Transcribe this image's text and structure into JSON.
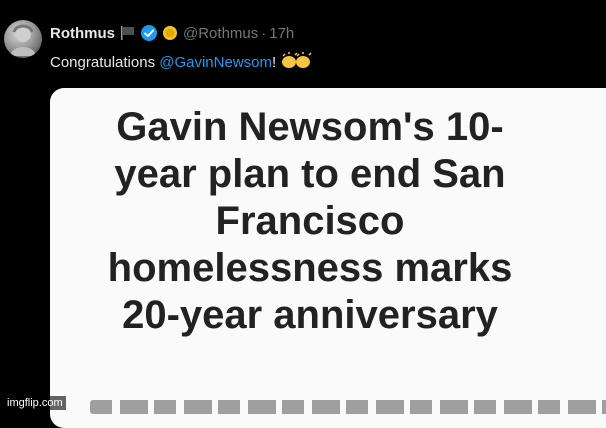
{
  "tweet": {
    "display_name": "Rothmus",
    "handle": "@Rothmus",
    "separator": "·",
    "time": "17h",
    "text_prefix": "Congratulations ",
    "mention": "@GavinNewsom",
    "text_suffix": "!",
    "icons": [
      "avatar",
      "flag-icon",
      "verified-badge-icon",
      "coin-icon",
      "clapping-hands-icon"
    ]
  },
  "card": {
    "headline_lines": [
      "Gavin Newsom's 10-",
      "year plan to end San",
      "Francisco",
      "homelessness marks",
      "20-year anniversary"
    ]
  },
  "watermark": "imgflip.com",
  "colors": {
    "background": "#000000",
    "mention": "#1d9bf0",
    "verified": "#1d9bf0",
    "muted": "#71767b",
    "card": "#fafafa",
    "headline": "#222222"
  }
}
